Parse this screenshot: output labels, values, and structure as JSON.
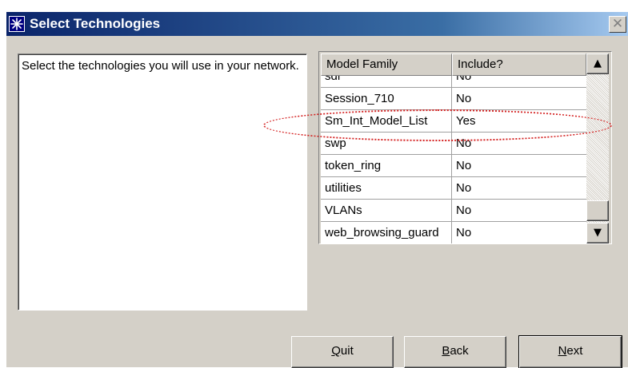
{
  "window": {
    "title": "Select Technologies",
    "close_glyph": "✕",
    "icon": "asterisk-app-icon"
  },
  "description": {
    "text": "Select the technologies you will use in your network."
  },
  "grid": {
    "columns": [
      "Model Family",
      "Include?"
    ],
    "rows": [
      {
        "family": "sdr",
        "include": "No"
      },
      {
        "family": "Session_710",
        "include": "No"
      },
      {
        "family": "Sm_Int_Model_List",
        "include": "Yes"
      },
      {
        "family": "swp",
        "include": "No"
      },
      {
        "family": "token_ring",
        "include": "No"
      },
      {
        "family": "utilities",
        "include": "No"
      },
      {
        "family": "VLANs",
        "include": "No"
      },
      {
        "family": "web_browsing_guard",
        "include": "No"
      }
    ],
    "highlighted_row": "Sm_Int_Model_List"
  },
  "scrollbar": {
    "up_glyph": "▲",
    "down_glyph": "▼",
    "position_fraction": 0.85
  },
  "buttons": {
    "quit": {
      "accel": "Q",
      "rest": "uit"
    },
    "back": {
      "accel": "B",
      "rest": "ack"
    },
    "next": {
      "accel": "N",
      "rest": "ext"
    }
  },
  "colors": {
    "titlebar_start": "#0a246a",
    "titlebar_end": "#a6caf0",
    "dialog_face": "#d4d0c8",
    "annotation_ring": "#d42020"
  }
}
